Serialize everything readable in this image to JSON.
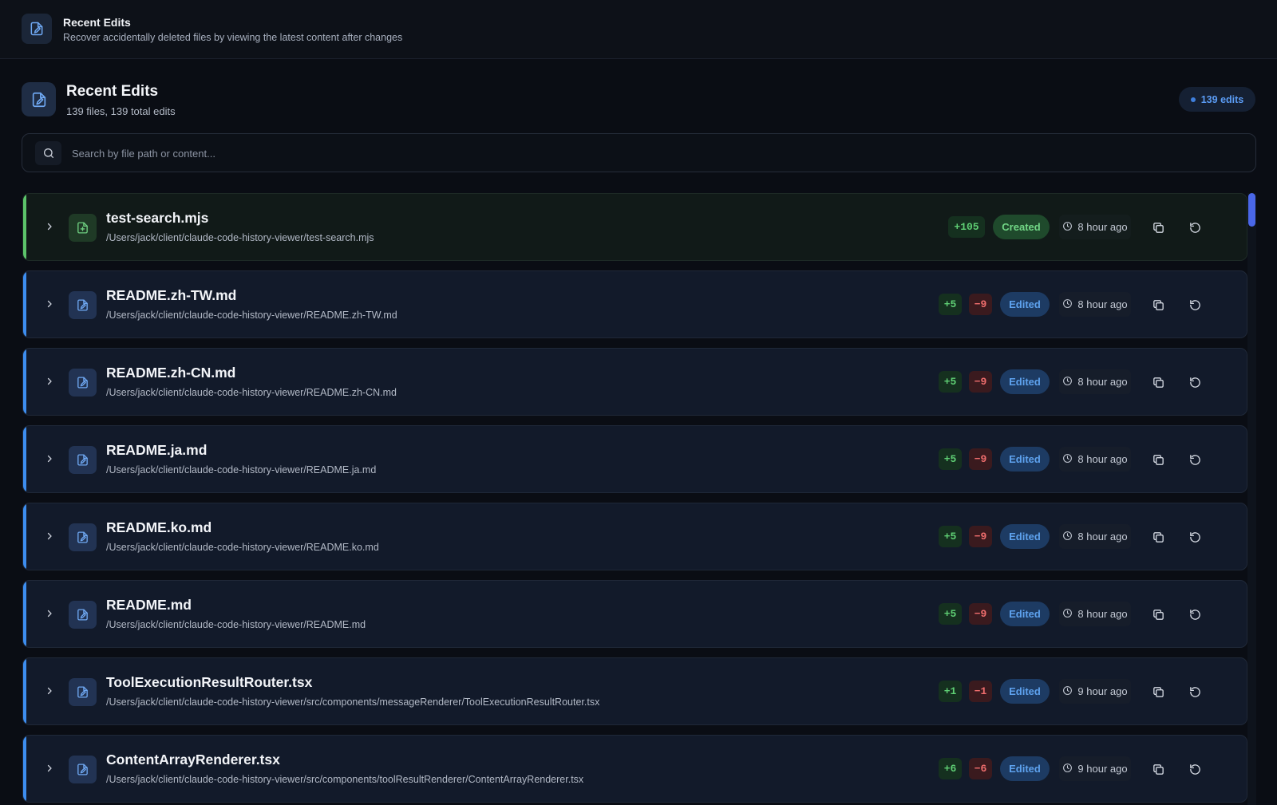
{
  "header": {
    "title": "Recent Edits",
    "subtitle": "Recover accidentally deleted files by viewing the latest content after changes"
  },
  "section": {
    "title": "Recent Edits",
    "summary": "139 files, 139 total edits",
    "count_label": "139 edits"
  },
  "search": {
    "placeholder": "Search by file path or content...",
    "value": ""
  },
  "colors": {
    "added": "#5fcf74",
    "removed": "#ef6d6d",
    "edited_accent": "#3d8ef0",
    "created_accent": "#5cc46a"
  },
  "files": [
    {
      "name": "test-search.mjs",
      "path": "/Users/jack/client/claude-code-history-viewer/test-search.mjs",
      "added": "+105",
      "removed": "",
      "status": "Created",
      "time": "8 hour ago"
    },
    {
      "name": "README.zh-TW.md",
      "path": "/Users/jack/client/claude-code-history-viewer/README.zh-TW.md",
      "added": "+5",
      "removed": "−9",
      "status": "Edited",
      "time": "8 hour ago"
    },
    {
      "name": "README.zh-CN.md",
      "path": "/Users/jack/client/claude-code-history-viewer/README.zh-CN.md",
      "added": "+5",
      "removed": "−9",
      "status": "Edited",
      "time": "8 hour ago"
    },
    {
      "name": "README.ja.md",
      "path": "/Users/jack/client/claude-code-history-viewer/README.ja.md",
      "added": "+5",
      "removed": "−9",
      "status": "Edited",
      "time": "8 hour ago"
    },
    {
      "name": "README.ko.md",
      "path": "/Users/jack/client/claude-code-history-viewer/README.ko.md",
      "added": "+5",
      "removed": "−9",
      "status": "Edited",
      "time": "8 hour ago"
    },
    {
      "name": "README.md",
      "path": "/Users/jack/client/claude-code-history-viewer/README.md",
      "added": "+5",
      "removed": "−9",
      "status": "Edited",
      "time": "8 hour ago"
    },
    {
      "name": "ToolExecutionResultRouter.tsx",
      "path": "/Users/jack/client/claude-code-history-viewer/src/components/messageRenderer/ToolExecutionResultRouter.tsx",
      "added": "+1",
      "removed": "−1",
      "status": "Edited",
      "time": "9 hour ago"
    },
    {
      "name": "ContentArrayRenderer.tsx",
      "path": "/Users/jack/client/claude-code-history-viewer/src/components/toolResultRenderer/ContentArrayRenderer.tsx",
      "added": "+6",
      "removed": "−6",
      "status": "Edited",
      "time": "9 hour ago"
    }
  ],
  "icons": {
    "header": "file-edit-icon",
    "search": "search-icon",
    "expand": "chevron-right-icon",
    "edited_file": "file-edit-icon",
    "created_file": "file-plus-icon",
    "time": "clock-icon",
    "copy": "copy-icon",
    "restore": "restore-icon"
  }
}
